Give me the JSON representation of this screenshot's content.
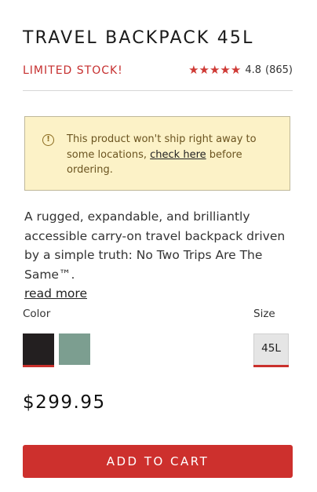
{
  "product": {
    "title": "TRAVEL BACKPACK 45L",
    "stock_status": "LIMITED STOCK!",
    "rating_value": "4.8",
    "rating_count": "(865)",
    "stars": "★★★★★"
  },
  "notice": {
    "text_before": "This product won't ship right away to some locations, ",
    "link_text": "check here",
    "text_after": " before ordering.",
    "icon": "info-icon"
  },
  "description": {
    "text": "A rugged, expandable, and brilliantly accessible carry-on travel backpack driven by a simple truth: No Two Trips Are The Same™.",
    "read_more": "read more"
  },
  "options": {
    "color_label": "Color",
    "size_label": "Size",
    "colors": [
      {
        "name": "black",
        "hex": "#231f20",
        "selected": true
      },
      {
        "name": "sage",
        "hex": "#7c9e90",
        "selected": false
      }
    ],
    "size_value": "45L"
  },
  "price": "$299.95",
  "cart": {
    "button_label": "ADD TO CART"
  },
  "colors": {
    "accent": "#cd302d",
    "notice_bg": "#fcf2c7"
  }
}
